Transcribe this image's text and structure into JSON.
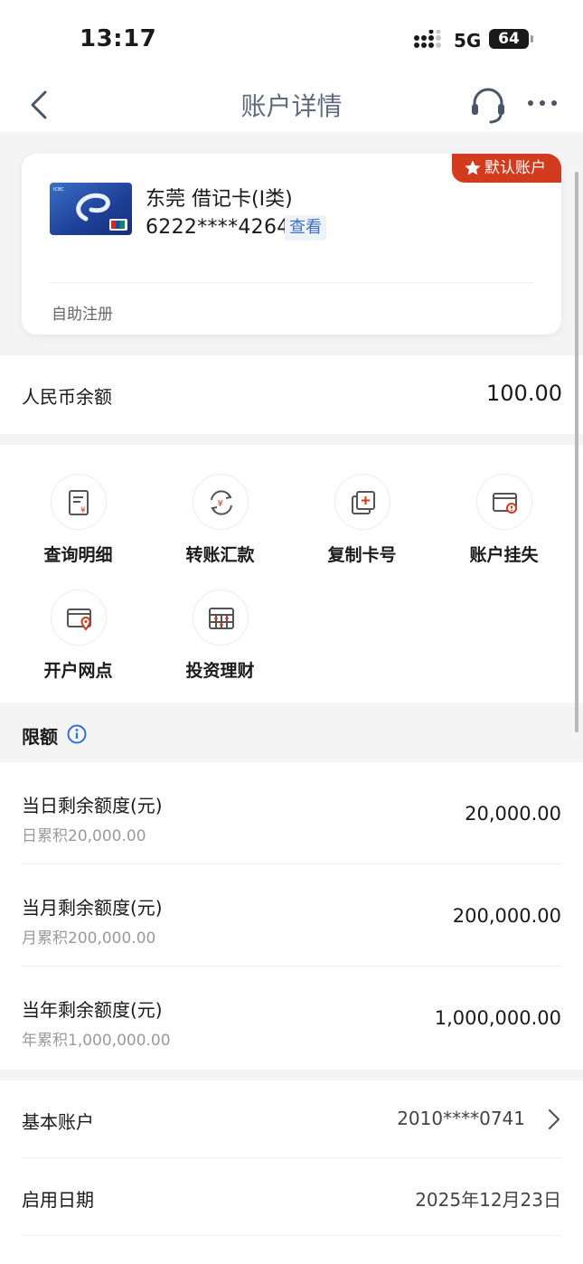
{
  "status_bar": {
    "time": "13:17",
    "network": "5G",
    "battery": "64"
  },
  "nav": {
    "title": "账户详情"
  },
  "card": {
    "badge": "默认账户",
    "name": "东莞 借记卡(Ⅰ类)",
    "number": "6222****4264",
    "view_label": "查看",
    "subtitle": "自助注册"
  },
  "balance": {
    "label": "人民币余额",
    "value": "100.00"
  },
  "actions": [
    {
      "label": "查询明细",
      "icon": "statement-icon"
    },
    {
      "label": "转账汇款",
      "icon": "transfer-icon"
    },
    {
      "label": "复制卡号",
      "icon": "copy-card-icon"
    },
    {
      "label": "账户挂失",
      "icon": "report-loss-icon"
    },
    {
      "label": "开户网点",
      "icon": "branch-location-icon"
    },
    {
      "label": "投资理财",
      "icon": "investment-icon"
    }
  ],
  "limits": {
    "title": "限额",
    "rows": [
      {
        "title": "当日剩余额度(元)",
        "sub": "日累积20,000.00",
        "value": "20,000.00"
      },
      {
        "title": "当月剩余额度(元)",
        "sub": "月累积200,000.00",
        "value": "200,000.00"
      },
      {
        "title": "当年剩余额度(元)",
        "sub": "年累积1,000,000.00",
        "value": "1,000,000.00"
      }
    ]
  },
  "info": [
    {
      "label": "基本账户",
      "value": "2010****0741"
    },
    {
      "label": "启用日期",
      "value": "2025年12月23日"
    }
  ],
  "colors": {
    "accent_red": "#d23b1e",
    "link_blue": "#3e6fc4",
    "icon_blue": "#2f6fd6"
  }
}
